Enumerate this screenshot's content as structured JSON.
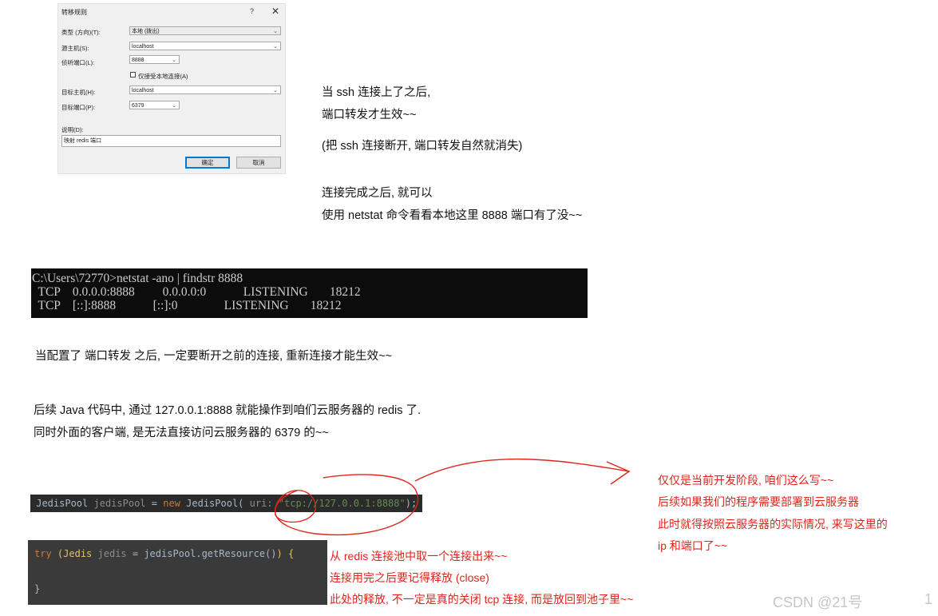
{
  "dialog": {
    "title": "转移规则",
    "help": "?",
    "close": "✕",
    "type_label": "类型 (方向)(T):",
    "type_value": "本地 (拨出)",
    "source_host_label": "源主机(S):",
    "source_host_value": "localhost",
    "listen_port_label": "侦听端口(L):",
    "listen_port_value": "8888",
    "local_only_label": "仅接受本地连接(A)",
    "dest_host_label": "目标主机(H):",
    "dest_host_value": "localhost",
    "dest_port_label": "目标端口(P):",
    "dest_port_value": "6379",
    "desc_label": "说明(D):",
    "desc_value": "映射 redis 端口",
    "ok": "确定",
    "cancel": "取消"
  },
  "notes": {
    "line1": "当 ssh 连接上了之后,",
    "line2": "端口转发才生效~~",
    "line3": "(把 ssh 连接断开, 端口转发自然就消失)",
    "line4": "连接完成之后, 就可以",
    "line5": "使用 netstat 命令看看本地这里 8888 端口有了没~~",
    "line6": "当配置了 端口转发 之后, 一定要断开之前的连接, 重新连接才能生效~~",
    "line7": "后续 Java 代码中, 通过 127.0.0.1:8888 就能操作到咱们云服务器的 redis 了.",
    "line8": "同时外面的客户端, 是无法直接访问云服务器的 6379 的~~"
  },
  "terminal": {
    "lines": [
      "C:\\Users\\72770>netstat -ano | findstr 8888",
      "  TCP    0.0.0.0:8888         0.0.0.0:0            LISTENING       18212",
      "  TCP    [::]:8888            [::]:0               LISTENING       18212"
    ]
  },
  "code1": {
    "type": "JedisPool",
    "var": "jedisPool",
    "eq": "=",
    "new": "new",
    "ctor": "JedisPool(",
    "param": "uri:",
    "url": "\"tcp://127.0.0.1:8888\"",
    "close": ");"
  },
  "code2": {
    "try": "try",
    "open": "(Jedis",
    "var": "jedis",
    "rest": "= jedisPool.getResource()",
    "close": ") {",
    "brace": "}"
  },
  "red_notes": {
    "right1": "仅仅是当前开发阶段, 咱们这么写~~",
    "right2": "后续如果我们的程序需要部署到云服务器",
    "right3": "此时就得按照云服务器的实际情况, 来写这里的",
    "right4": "ip 和端口了~~",
    "bottom1": "从 redis 连接池中取一个连接出来~~",
    "bottom2": "连接用完之后要记得释放 (close)",
    "bottom3": "此处的释放, 不一定是真的关闭 tcp 连接, 而是放回到池子里~~"
  },
  "watermark": "CSDN @21号",
  "page_number": "1",
  "colors": {
    "annotation_red": "#e0241b",
    "terminal_bg": "#0c0c0c",
    "code_bg": "#2b2b2b"
  }
}
